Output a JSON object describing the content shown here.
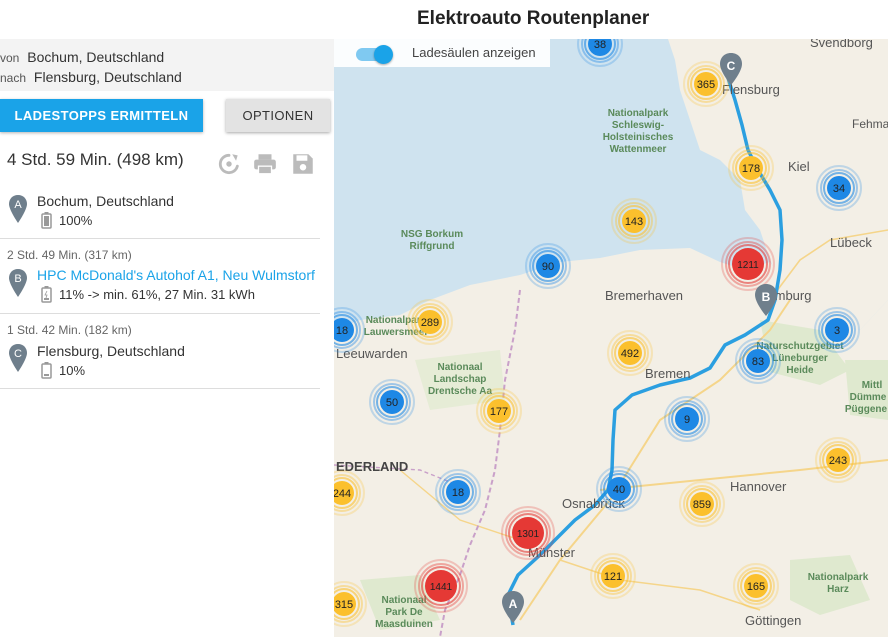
{
  "header": {
    "title": "Elektroauto Routenplaner"
  },
  "route": {
    "from_label": "von",
    "from_value": "Bochum, Deutschland",
    "to_label": "nach",
    "to_value": "Flensburg, Deutschland"
  },
  "actions": {
    "primary": "Ladestopps ermitteln",
    "secondary": "Optionen"
  },
  "summary": {
    "text": "4 Std. 59 Min. (498 km)"
  },
  "toolbar": {
    "icons": [
      "reload-icon",
      "print-icon",
      "save-icon"
    ]
  },
  "stops": [
    {
      "letter": "A",
      "leg": "",
      "name": "Bochum, Deutschland",
      "battery": "100%",
      "battery_level": 1.0,
      "is_link": false
    },
    {
      "letter": "B",
      "leg": "2 Std. 49 Min. (317 km)",
      "name": "HPC McDonald's Autohof A1, Neu Wulmstorf",
      "battery": "11% -> min. 61%, 27 Min. 31 kWh",
      "battery_level": 0.11,
      "is_link": true
    },
    {
      "letter": "C",
      "leg": "1 Std. 42 Min. (182 km)",
      "name": "Flensburg, Deutschland",
      "battery": "10%",
      "battery_level": 0.1,
      "is_link": false
    }
  ],
  "map": {
    "toggle_label": "Ladesäulen anzeigen",
    "toggle_on": true,
    "colors": {
      "small_cluster": "#1e88e5",
      "medium_cluster": "#fbc02d",
      "large_cluster": "#e53935",
      "route": "#2b9fe0",
      "water": "#cfe3ef",
      "land": "#f3efe6",
      "marker": "#6f7f8c"
    },
    "cities": [
      "Svendborg",
      "Flensburg",
      "Kiel",
      "Fehma",
      "Lübeck",
      "Bremerhaven",
      "Hamburg",
      "Bremen",
      "Leeuwarden",
      "Osnabrück",
      "Hannover",
      "Münster",
      "Göttingen"
    ],
    "areas": [
      "Nationalpark Schleswig-Holsteinisches Wattenmeer",
      "NSG Borkum Riffgrund",
      "Nationalpark Lauwersmeer",
      "Nationaal Landschap Drentsche Aa",
      "Naturschutzgebiet Lüneburger Heide",
      "Nationalpark Harz",
      "Nationaal Park De Maasduinen",
      "Mittl. Dümme Püggene"
    ],
    "country_label": "EDERLAND",
    "clusters": [
      "38",
      "365",
      "178",
      "34",
      "143",
      "1211",
      "90",
      "289",
      "18",
      "3",
      "492",
      "83",
      "50",
      "177",
      "9",
      "243",
      "18",
      "40",
      "859",
      "244",
      "1301",
      "121",
      "165",
      "1441",
      "315"
    ],
    "route_markers": [
      "A",
      "B",
      "C"
    ]
  }
}
